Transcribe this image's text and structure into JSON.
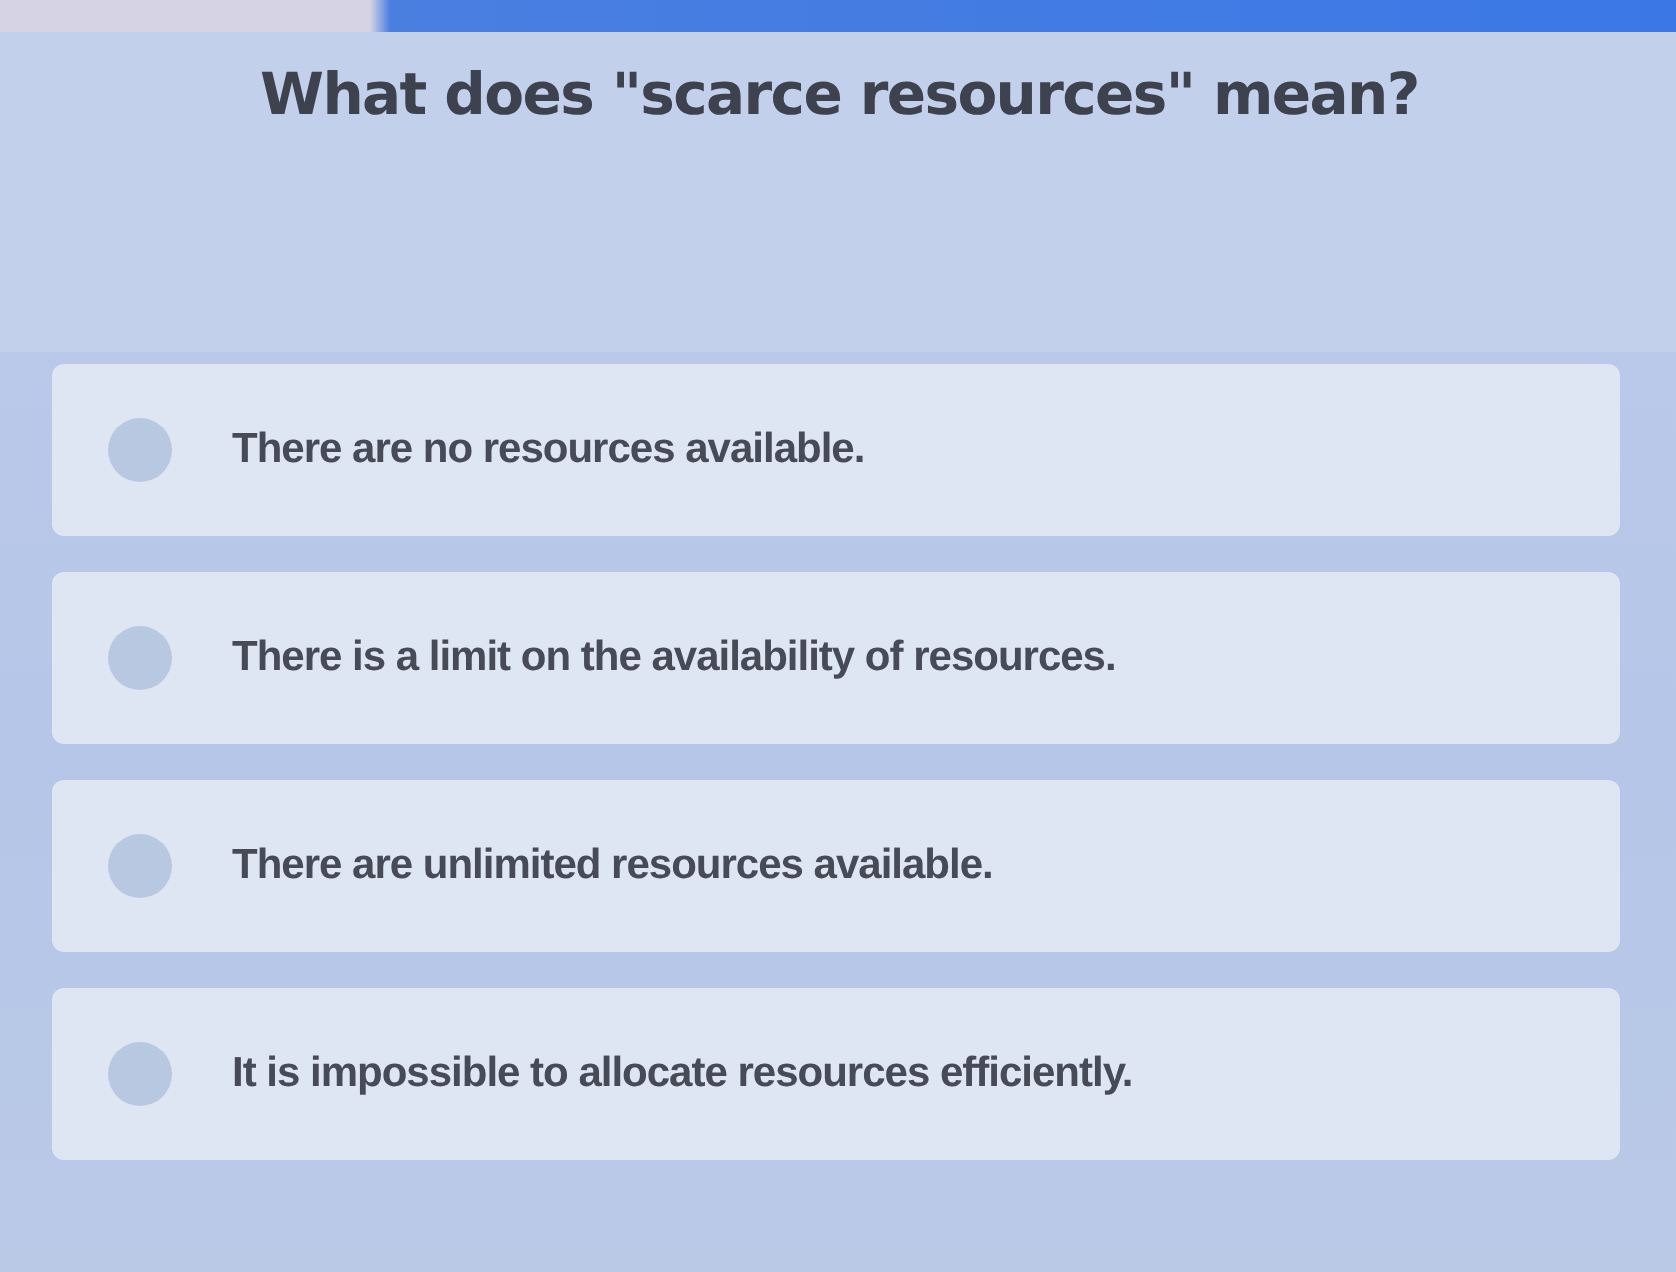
{
  "question": "What does \"scarce resources\" mean?",
  "options": [
    {
      "text": "There are no resources available.",
      "selected": false
    },
    {
      "text": "There is a limit on the availability of resources.",
      "selected": false
    },
    {
      "text": "There are unlimited resources available.",
      "selected": false
    },
    {
      "text": "It is impossible to allocate resources efficiently.",
      "selected": false
    }
  ]
}
